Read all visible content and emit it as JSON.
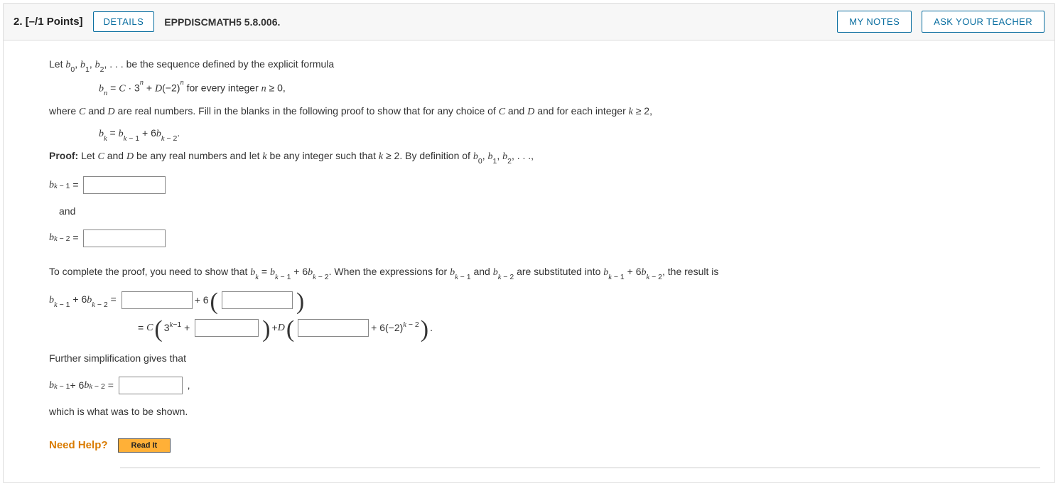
{
  "header": {
    "number": "2.",
    "points": "[–/1 Points]",
    "details": "DETAILS",
    "reference": "EPPDISCMATH5 5.8.006.",
    "my_notes": "MY NOTES",
    "ask_teacher": "ASK YOUR TEACHER"
  },
  "body": {
    "intro": "Let ",
    "seq": " . . . be the sequence defined by the explicit formula",
    "formula_tail": "  for every integer ",
    "where": "where ",
    "where2": " and ",
    "where3": " are real numbers. Fill in the blanks in the following proof to show that for any choice of ",
    "where4": " and ",
    "where5": " and for each integer ",
    "proof_label": "Proof:",
    "proof_text": " Let ",
    "proof_text2": " and ",
    "proof_text3": " be any real numbers and let ",
    "proof_text4": " be any integer such that ",
    "proof_text5": ". By definition of ",
    "and_word": "and",
    "complete1": "To complete the proof, you need to show that ",
    "complete2": ". When the expressions for ",
    "complete3": " and ",
    "complete4": " are substituted into ",
    "complete5": ", the result is",
    "plus6": " + 6",
    "plusD": " + ",
    "tail_expr": " + 6(−2)",
    "further": "Further simplification gives that",
    "which": "which is what was to be shown.",
    "need_help": "Need Help?",
    "read_it": "Read It"
  }
}
